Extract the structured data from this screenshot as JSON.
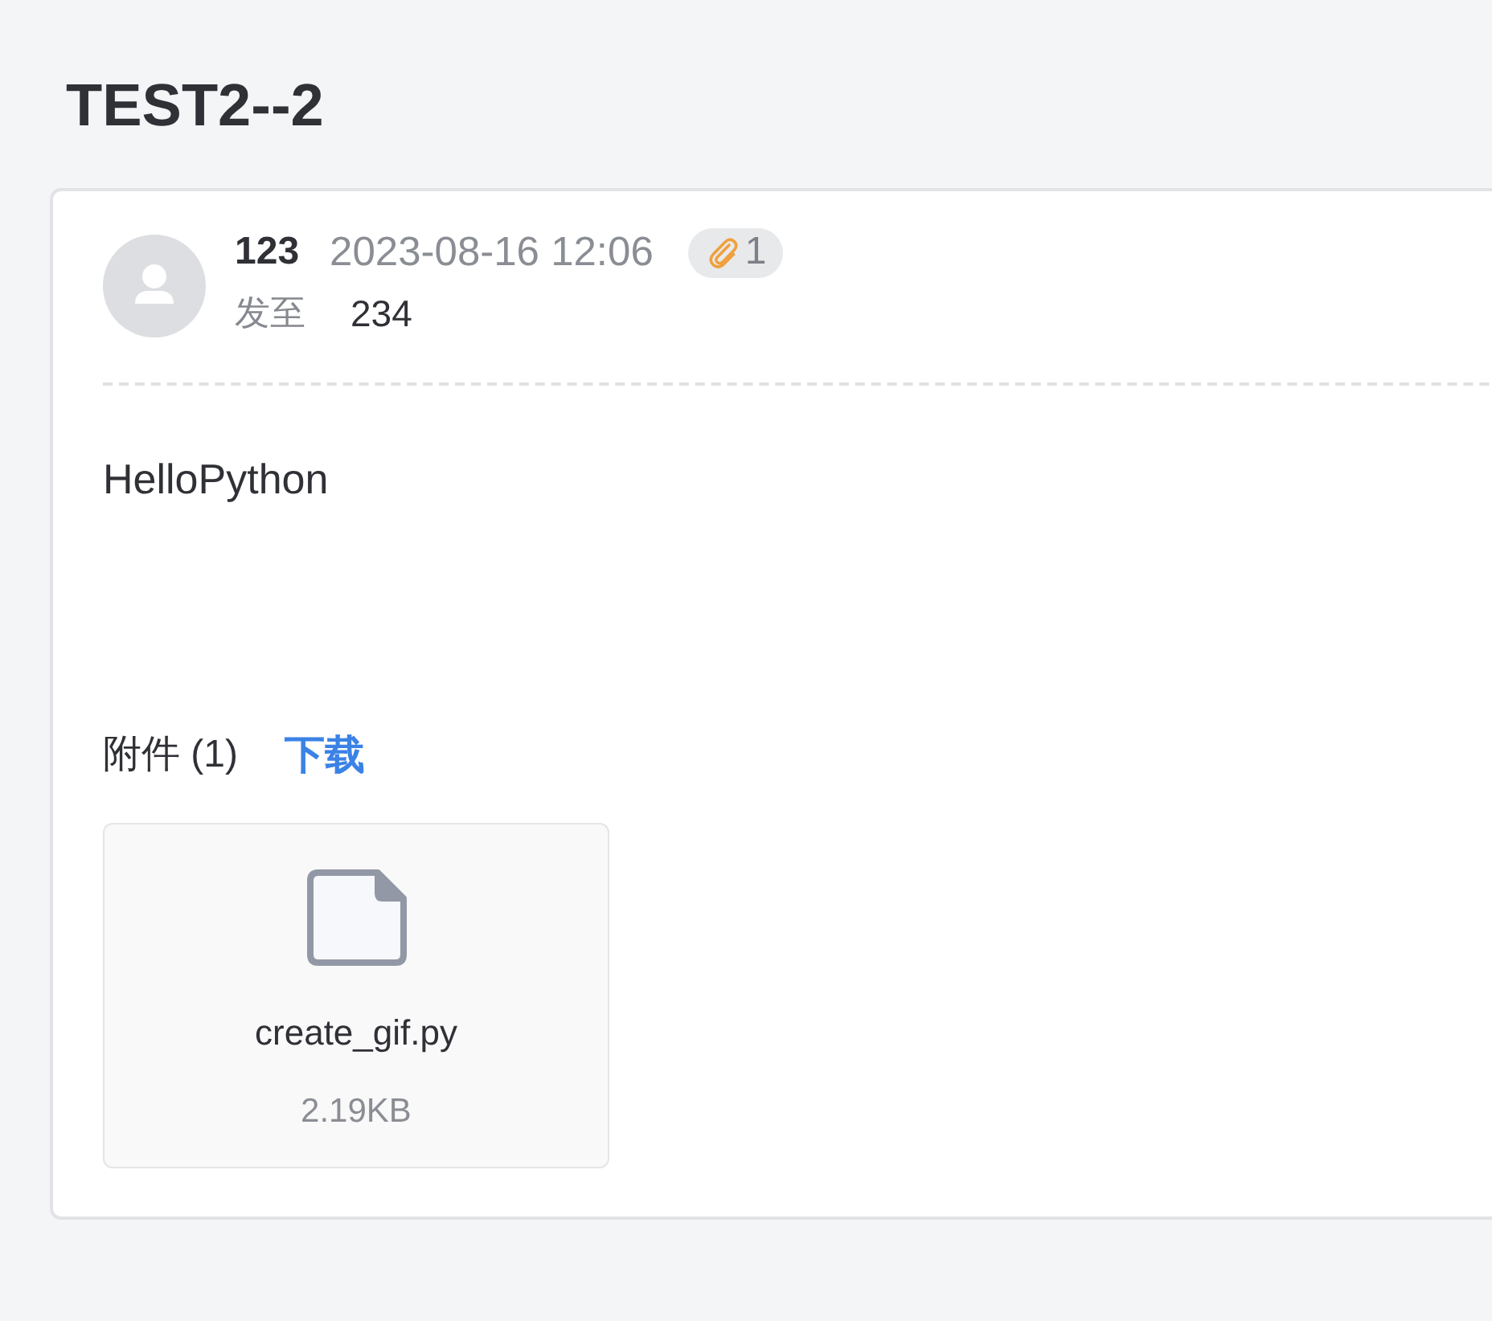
{
  "title": "TEST2--2",
  "message": {
    "sender": "123",
    "time": "2023-08-16 12:06",
    "attachment_count": "1",
    "recipient_label": "发至",
    "recipient": "234",
    "body": "HelloPython"
  },
  "attachments": {
    "label": "附件 (1)",
    "download": "下载",
    "files": [
      {
        "name": "create_gif.py",
        "size": "2.19KB"
      }
    ]
  }
}
